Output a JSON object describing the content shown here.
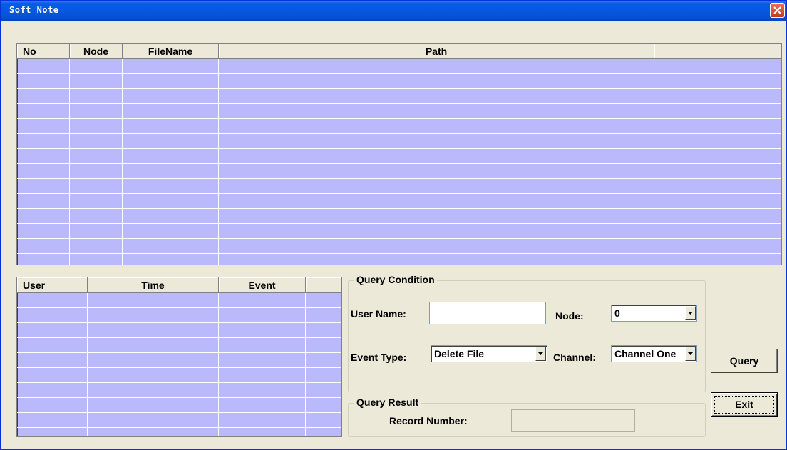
{
  "window": {
    "title": "Soft Note"
  },
  "file_table": {
    "columns": [
      "No",
      "Node",
      "FileName",
      "Path",
      ""
    ],
    "rows": []
  },
  "event_table": {
    "columns": [
      "User",
      "Time",
      "Event",
      ""
    ],
    "rows": []
  },
  "query_condition": {
    "legend": "Query Condition",
    "user_name_label": "User Name:",
    "user_name_value": "",
    "node_label": "Node:",
    "node_value": "0",
    "event_type_label": "Event Type:",
    "event_type_value": "Delete File",
    "channel_label": "Channel:",
    "channel_value": "Channel One"
  },
  "query_result": {
    "legend": "Query Result",
    "record_number_label": "Record Number:",
    "record_number_value": ""
  },
  "buttons": {
    "query": "Query",
    "exit": "Exit"
  },
  "colors": {
    "grid_bg": "#b9b9fb",
    "title_bar": "#0757e0",
    "window_bg": "#ece9d8"
  }
}
